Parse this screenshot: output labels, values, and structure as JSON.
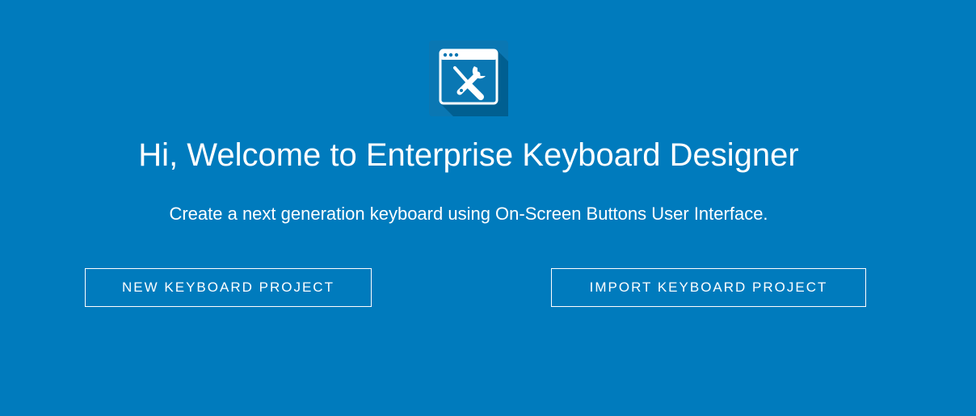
{
  "welcome": {
    "icon": "keyboard-designer-tools-icon",
    "title": "Hi, Welcome to Enterprise Keyboard Designer",
    "subtitle": "Create a next generation keyboard using On-Screen Buttons User Interface."
  },
  "actions": {
    "new_project_label": "NEW KEYBOARD PROJECT",
    "import_project_label": "IMPORT KEYBOARD PROJECT"
  },
  "colors": {
    "background": "#007bbd",
    "icon_tile": "#0a77b3",
    "icon_shadow": "#005f91",
    "text": "#ffffff"
  }
}
